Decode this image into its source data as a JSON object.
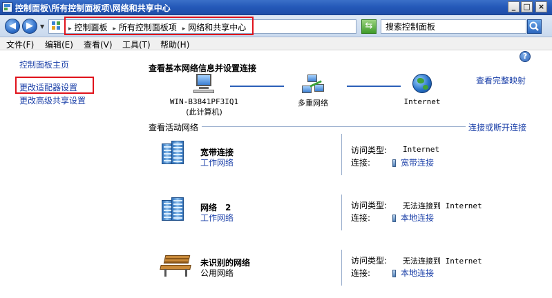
{
  "window": {
    "title": "控制面板\\所有控制面板项\\网络和共享中心",
    "minimize_glyph": "_",
    "maximize_glyph": "□",
    "close_glyph": "×"
  },
  "address": {
    "crumbs": [
      "控制面板",
      "所有控制面板项",
      "网络和共享中心"
    ],
    "search_placeholder": "搜索控制面板"
  },
  "menu": [
    "文件(F)",
    "编辑(E)",
    "查看(V)",
    "工具(T)",
    "帮助(H)"
  ],
  "sidebar": {
    "items": [
      "控制面板主页",
      "更改适配器设置",
      "更改高级共享设置"
    ]
  },
  "main": {
    "heading": "查看基本网络信息并设置连接",
    "full_map_link": "查看完整映射",
    "map": {
      "computer_name": "WIN-B3841PF3IQ1",
      "computer_sub": "(此计算机)",
      "middle": "多重网络",
      "internet": "Internet"
    },
    "active_title": "查看活动网络",
    "connect_link": "连接或断开连接",
    "networks": [
      {
        "name": "宽带连接",
        "type": "工作网络",
        "access_label": "访问类型:",
        "access_value": "Internet",
        "conn_label": "连接:",
        "conn_value": "宽带连接"
      },
      {
        "name": "网络　2",
        "type": "工作网络",
        "access_label": "访问类型:",
        "access_value": "无法连接到 Internet",
        "conn_label": "连接:",
        "conn_value": "本地连接"
      },
      {
        "name": "未识别的网络",
        "type": "公用网络",
        "access_label": "访问类型:",
        "access_value": "无法连接到 Internet",
        "conn_label": "连接:",
        "conn_value": "本地连接"
      }
    ]
  },
  "colors": {
    "link": "#1a3fa8",
    "highlight": "#e0121b",
    "titlebar": "#2458b8"
  }
}
